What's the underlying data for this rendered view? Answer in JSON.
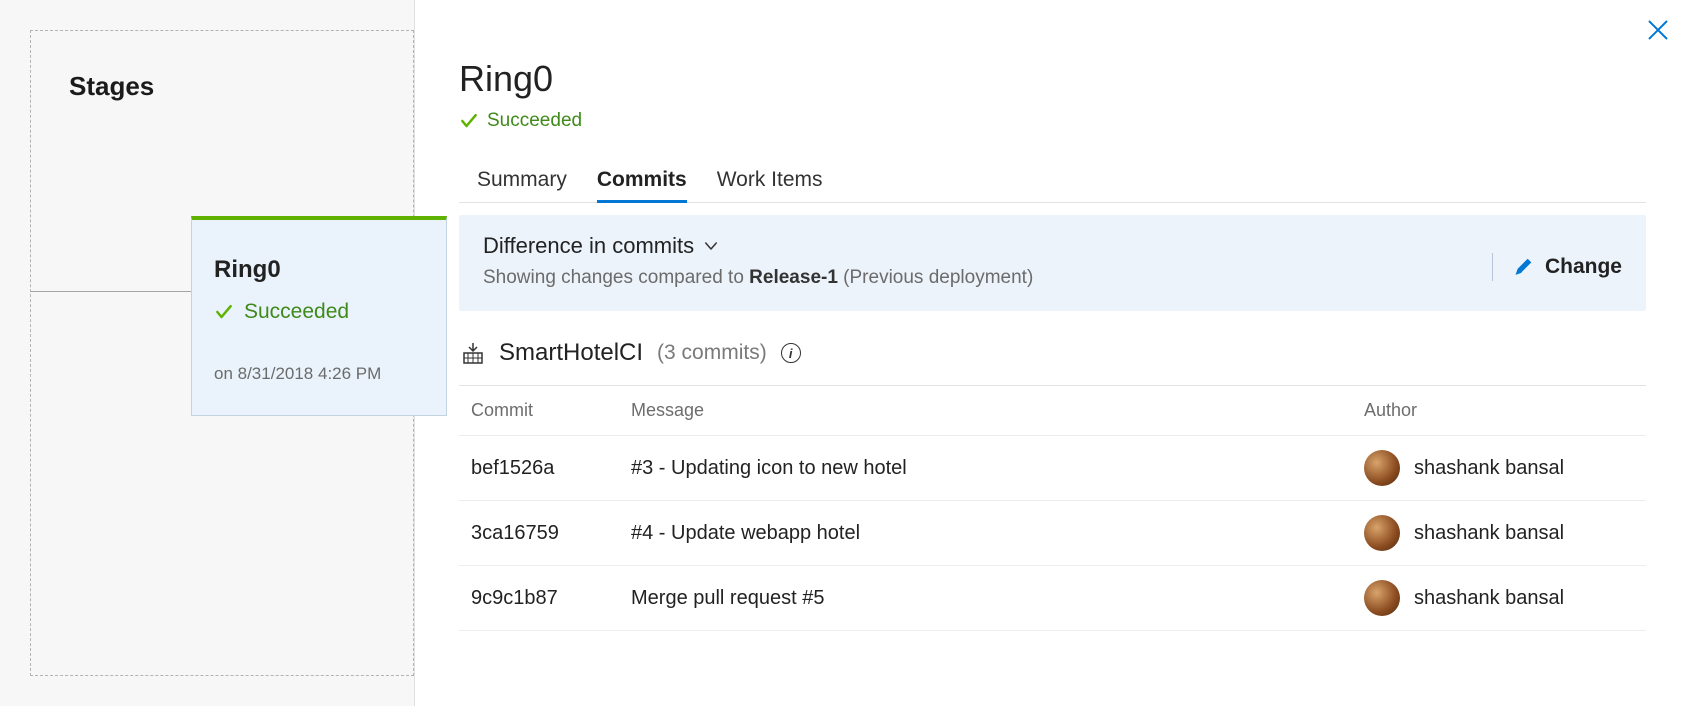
{
  "left": {
    "stages_title": "Stages",
    "card": {
      "title": "Ring0",
      "status": "Succeeded",
      "date": "on 8/31/2018 4:26 PM"
    }
  },
  "panel": {
    "title": "Ring0",
    "status": "Succeeded"
  },
  "tabs": {
    "summary": "Summary",
    "commits": "Commits",
    "workitems": "Work Items"
  },
  "diff": {
    "title": "Difference in commits",
    "subtext_prefix": "Showing changes compared to ",
    "release": "Release-1",
    "subtext_suffix": " (Previous deployment)",
    "change": "Change"
  },
  "build": {
    "name": "SmartHotelCI",
    "count": "(3 commits)"
  },
  "headers": {
    "commit": "Commit",
    "message": "Message",
    "author": "Author"
  },
  "commits": [
    {
      "id": "bef1526a",
      "message": "#3 - Updating icon to new hotel",
      "author": "shashank bansal"
    },
    {
      "id": "3ca16759",
      "message": "#4 - Update webapp hotel",
      "author": "shashank bansal"
    },
    {
      "id": "9c9c1b87",
      "message": "Merge pull request #5",
      "author": "shashank bansal"
    }
  ]
}
